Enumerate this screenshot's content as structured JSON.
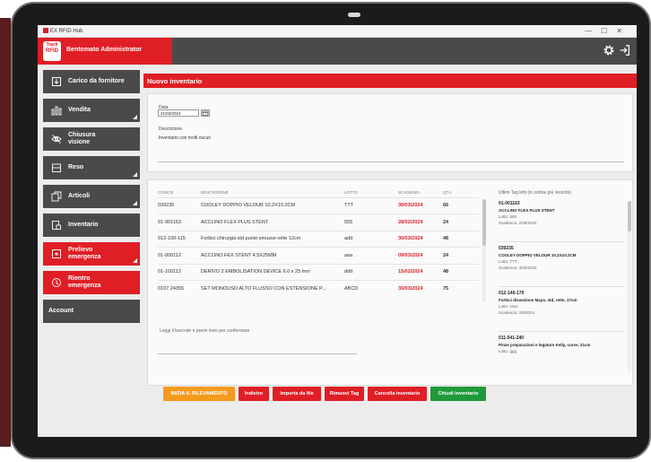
{
  "window": {
    "title": "EX RFID Hub",
    "controls": [
      "—",
      "☐",
      "✕"
    ]
  },
  "header": {
    "logo_text": [
      "Track",
      "RFID"
    ],
    "title": "Bentomato Administrator",
    "settings_icon": "gear-icon",
    "logout_icon": "exit-icon"
  },
  "sidebar": {
    "items": [
      {
        "label": "Carico da fornitore",
        "icon": "box-arrow-icon",
        "style": "dark"
      },
      {
        "label": "Vendita",
        "icon": "bars-icon",
        "style": "dark"
      },
      {
        "label": "Chiusura visione",
        "icon": "eye-off-icon",
        "style": "dark"
      },
      {
        "label": "Reso",
        "icon": "return-icon",
        "style": "dark"
      },
      {
        "label": "Articoli",
        "icon": "copy-icon",
        "style": "dark"
      },
      {
        "label": "Inventario",
        "icon": "inventory-icon",
        "style": "dark"
      },
      {
        "label": "Prelievo emergenza",
        "icon": "emergency-out-icon",
        "style": "red"
      },
      {
        "label": "Rientro emergenza",
        "icon": "emergency-in-icon",
        "style": "red"
      },
      {
        "label": "Account",
        "icon": "",
        "style": "dark"
      }
    ]
  },
  "page": {
    "title": "Nuovo inventario",
    "date_label": "Data",
    "date_value": "21/03/2024",
    "description_label": "Descrizione",
    "description_value": "Inventario con molti oscuri"
  },
  "table": {
    "headers": [
      "CODICE",
      "DESCRIZIONE",
      "LOTTO",
      "SCADENZA",
      "QTÀ"
    ],
    "rows": [
      {
        "code": "039235",
        "desc": "COOLEY DOPPIO VELOUR 10.2X10.2CM",
        "lot": "TTT",
        "expiry": "30/03/2024",
        "qty": "66"
      },
      {
        "code": "01-001163",
        "desc": "ACCLINO FLEX PLUS STENT",
        "lot": "555",
        "expiry": "28/02/2024",
        "qty": "24"
      },
      {
        "code": "012-100-115",
        "desc": "Forbici chirurgia std punte smusse rette 12cm",
        "lot": "add",
        "expiry": "30/03/2024",
        "qty": "48"
      },
      {
        "code": "01-000112",
        "desc": "ACCLINO FEX STENT 4.5X25MM",
        "lot": "aaa",
        "expiry": "09/03/2024",
        "qty": "24"
      },
      {
        "code": "01-100112",
        "desc": "DERIVO 2 EMBOLISATION DEVICE 6.0 x 25 mm",
        "lot": "ddd",
        "expiry": "15/02/2024",
        "qty": "48"
      },
      {
        "code": "0107.24355",
        "desc": "SET MONOUSO ALTO FLUSSO CON ESTENSIONE P...",
        "lot": "ABCD",
        "expiry": "30/03/2024",
        "qty": "75"
      }
    ]
  },
  "rfid_panel": {
    "title": "Ultimi Tag letti (in ordine più recente)",
    "items": [
      {
        "code": "01-001163",
        "desc": "ACCLINO FLEX PLUS STENT",
        "lot": "Lotto: 555",
        "expiry": "Scadenza: 2/28/2024"
      },
      {
        "code": "039235",
        "desc": "COOLEY DOPPIO VELOUR 10.2X10.2CM",
        "lot": "Lotto: TTT",
        "expiry": "Scadenza: 3/30/2024"
      },
      {
        "code": "012-140-170",
        "desc": "Forbici dissezione Mayo, std, rette, 17cm",
        "lot": "Lotto: ssss",
        "expiry": "Scadenza: 3/9/2024"
      },
      {
        "code": "011-541-240",
        "desc": "Pinze preparazioni e legature Kelly, curve, 21cm",
        "lot": "Lotto: ggg",
        "expiry": ""
      }
    ]
  },
  "barcode_hint": "Leggi il barcode e premi invio per confermare",
  "buttons": {
    "start": "INIZIA IL RILEVAMENTO",
    "back": "Indietro",
    "import": "Importa da file",
    "remove": "Rimuovi Tag",
    "cancel": "Cancella inventario",
    "close": "Chiudi inventario"
  },
  "colors": {
    "accent": "#e01e25",
    "dark": "#4a4a4a",
    "start": "#f59a1e",
    "close": "#1f9a3a"
  }
}
